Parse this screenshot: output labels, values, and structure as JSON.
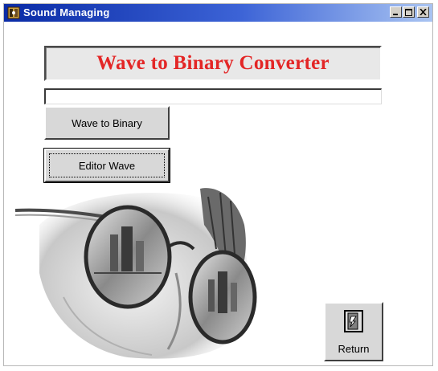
{
  "window": {
    "title": "Sound Managing"
  },
  "banner": {
    "title": "Wave to Binary Converter",
    "title_color": "#e32626"
  },
  "status_field": {
    "value": ""
  },
  "buttons": {
    "wave_to_binary": "Wave to Binary",
    "editor_wave": "Editor Wave",
    "return": "Return"
  },
  "icons": {
    "app": "app-icon",
    "return": "door-exit-icon",
    "illustration": "face-with-glasses-reflection"
  },
  "colors": {
    "titlebar": "#0a2ba6",
    "button_face": "#d8d8d8"
  }
}
